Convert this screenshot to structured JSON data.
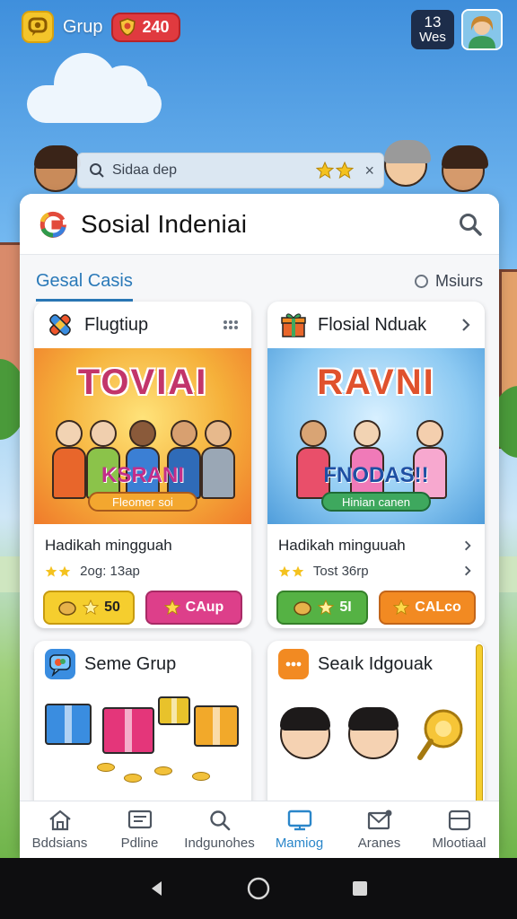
{
  "topbar": {
    "app_name": "Grup",
    "coins": "240",
    "level_number": "13",
    "level_label": "Wes"
  },
  "search_strip": {
    "text": "Sidaa dep",
    "close_glyph": "×"
  },
  "panel": {
    "title": "Sosial Indeniai",
    "active_tab": "Gesal Casis",
    "sort_option": "Msiurs"
  },
  "cards": [
    {
      "title": "Flugtiup",
      "art_headline": "TOVIAI",
      "art_sub": "KSRANI",
      "art_banner": "Fleomer soi",
      "name": "Hadikah mingguah",
      "rating_text": "2og: 13ap",
      "btn_a": "50",
      "btn_b": "CAup"
    },
    {
      "title": "Flosial Nduak",
      "art_headline": "RAVNI",
      "art_sub": "FNODAS!!",
      "art_banner": "Hinian canen",
      "name": "Hadikah minguuah",
      "rating_text": "Tost 36rp",
      "btn_a": "5I",
      "btn_b": "CALco"
    },
    {
      "title": "Seme Grup"
    },
    {
      "title": "Seaık Idgouak"
    }
  ],
  "bottom_nav": [
    {
      "label": "Bddsians",
      "icon": "home-icon"
    },
    {
      "label": "Pdline",
      "icon": "profile-card-icon"
    },
    {
      "label": "Indgunohes",
      "icon": "search-icon"
    },
    {
      "label": "Mamiog",
      "icon": "tv-icon"
    },
    {
      "label": "Aranes",
      "icon": "mail-icon"
    },
    {
      "label": "Mlootiaal",
      "icon": "window-icon"
    }
  ],
  "colors": {
    "accent": "#2a79b8",
    "coin_pill": "#e03a3f",
    "yellow_button": "#f5ce2e",
    "pink_button": "#dd3f8a",
    "green_button": "#55b244",
    "orange_button": "#f28a22"
  }
}
